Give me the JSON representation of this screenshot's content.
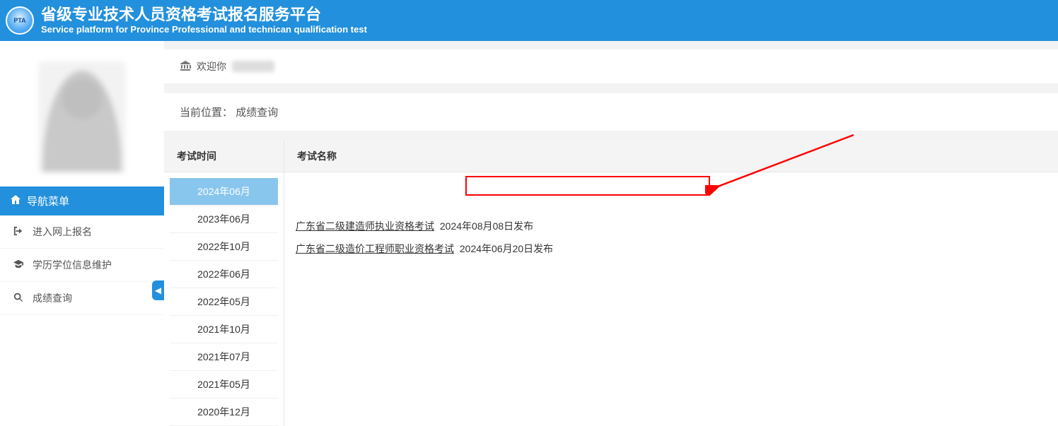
{
  "header": {
    "logo_text": "PTA",
    "title_cn": "省级专业技术人员资格考试报名服务平台",
    "title_en": "Service platform for Province Professional and technican qualification test"
  },
  "welcome": {
    "prefix": "欢迎你"
  },
  "breadcrumb": {
    "label": "当前位置：",
    "current": "成绩查询"
  },
  "sidebar": {
    "nav_title": "导航菜单",
    "items": [
      {
        "icon": "login-icon",
        "label": "进入网上报名"
      },
      {
        "icon": "graduation-icon",
        "label": "学历学位信息维护"
      },
      {
        "icon": "search-icon",
        "label": "成绩查询"
      }
    ]
  },
  "table": {
    "col_time": "考试时间",
    "col_name": "考试名称",
    "times": [
      "2024年06月",
      "2023年06月",
      "2022年10月",
      "2022年06月",
      "2022年05月",
      "2021年10月",
      "2021年07月",
      "2021年05月",
      "2020年12月"
    ],
    "active_index": 0,
    "exams": [
      {
        "name": "广东省二级建造师执业资格考试",
        "date_text": "2024年08月08日发布",
        "highlighted": true
      },
      {
        "name": "广东省二级造价工程师职业资格考试",
        "date_text": "2024年06月20日发布",
        "highlighted": false
      }
    ]
  }
}
